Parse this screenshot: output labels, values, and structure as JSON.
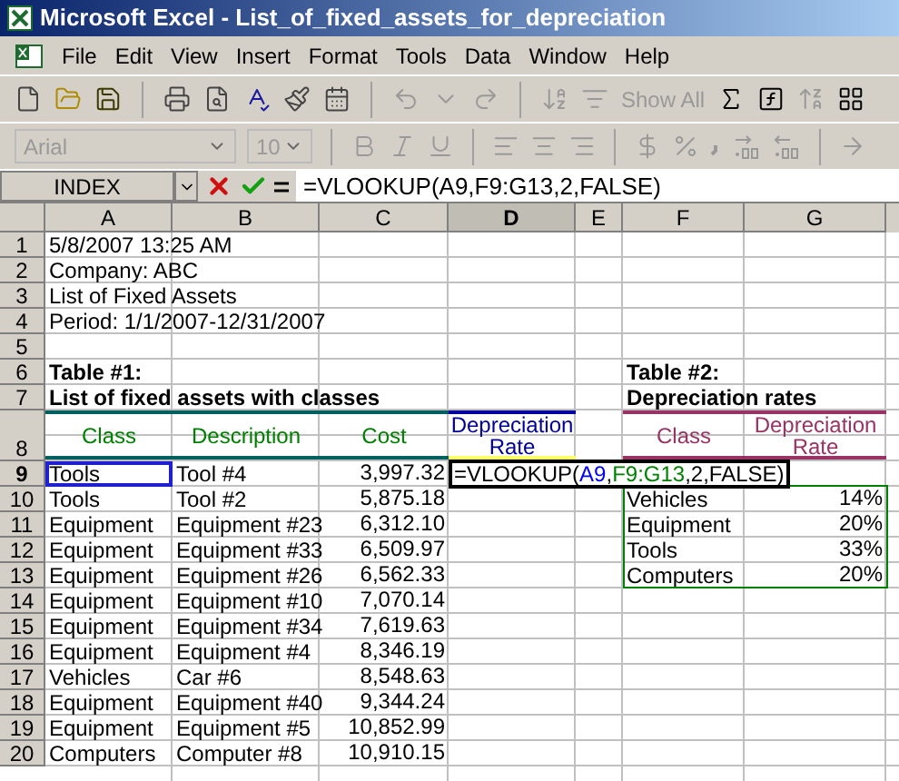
{
  "window": {
    "title": "Microsoft Excel - List_of_fixed_assets_for_depreciation"
  },
  "menu": [
    "File",
    "Edit",
    "View",
    "Insert",
    "Format",
    "Tools",
    "Data",
    "Window",
    "Help"
  ],
  "standard_toolbar": {
    "show_all": "Show All"
  },
  "formatting_toolbar": {
    "font": "Arial",
    "size": "10"
  },
  "formula_bar": {
    "name_box": "INDEX",
    "formula": "=VLOOKUP(A9,F9:G13,2,FALSE)"
  },
  "columns": [
    {
      "label": "A",
      "selected": false
    },
    {
      "label": "B",
      "selected": false
    },
    {
      "label": "C",
      "selected": false
    },
    {
      "label": "D",
      "selected": true
    },
    {
      "label": "E",
      "selected": false
    },
    {
      "label": "F",
      "selected": false
    },
    {
      "label": "G",
      "selected": false
    }
  ],
  "rows": [
    {
      "number": "1",
      "selected": false,
      "kind": "plain",
      "cells": [
        "5/8/2007 13:25 AM",
        "",
        "",
        "",
        "",
        "",
        ""
      ]
    },
    {
      "number": "2",
      "selected": false,
      "kind": "plain",
      "cells": [
        "Company: ABC",
        "",
        "",
        "",
        "",
        "",
        ""
      ]
    },
    {
      "number": "3",
      "selected": false,
      "kind": "plain",
      "cells": [
        "List of Fixed Assets",
        "",
        "",
        "",
        "",
        "",
        ""
      ]
    },
    {
      "number": "4",
      "selected": false,
      "kind": "plain",
      "cells": [
        "Period: 1/1/2007-12/31/2007",
        "",
        "",
        "",
        "",
        "",
        ""
      ]
    },
    {
      "number": "5",
      "selected": false,
      "kind": "plain",
      "cells": [
        "",
        "",
        "",
        "",
        "",
        "",
        ""
      ]
    },
    {
      "number": "6",
      "selected": false,
      "kind": "title",
      "cells": [
        "Table #1:",
        "",
        "",
        "",
        "",
        "Table #2:",
        ""
      ]
    },
    {
      "number": "7",
      "selected": false,
      "kind": "title",
      "cells": [
        "List of fixed assets with classes",
        "",
        "",
        "",
        "",
        "Depreciation rates",
        ""
      ]
    },
    {
      "number": "8",
      "selected": false,
      "kind": "header",
      "cells": [
        {
          "text": "Class",
          "color": "#008000"
        },
        {
          "text": "Description",
          "color": "#008000"
        },
        {
          "text": "Cost",
          "color": "#008000"
        },
        {
          "text": "Depreciation Rate",
          "color": "#000099"
        },
        "",
        {
          "text": "Class",
          "color": "#993366"
        },
        {
          "text": "Depreciation Rate",
          "color": "#993366"
        }
      ]
    },
    {
      "number": "9",
      "selected": true,
      "kind": "data",
      "cells": [
        "Tools",
        "Tool #4",
        "3,997.32",
        "",
        "",
        "",
        ""
      ]
    },
    {
      "number": "10",
      "selected": false,
      "kind": "data",
      "cells": [
        "Tools",
        "Tool #2",
        "5,875.18",
        "",
        "",
        "Vehicles",
        "14%"
      ]
    },
    {
      "number": "11",
      "selected": false,
      "kind": "data",
      "cells": [
        "Equipment",
        "Equipment #23",
        "6,312.10",
        "",
        "",
        "Equipment",
        "20%"
      ]
    },
    {
      "number": "12",
      "selected": false,
      "kind": "data",
      "cells": [
        "Equipment",
        "Equipment #33",
        "6,509.97",
        "",
        "",
        "Tools",
        "33%"
      ]
    },
    {
      "number": "13",
      "selected": false,
      "kind": "data",
      "cells": [
        "Equipment",
        "Equipment #26",
        "6,562.33",
        "",
        "",
        "Computers",
        "20%"
      ]
    },
    {
      "number": "14",
      "selected": false,
      "kind": "data",
      "cells": [
        "Equipment",
        "Equipment #10",
        "7,070.14",
        "",
        "",
        "",
        ""
      ]
    },
    {
      "number": "15",
      "selected": false,
      "kind": "data",
      "cells": [
        "Equipment",
        "Equipment #34",
        "7,619.63",
        "",
        "",
        "",
        ""
      ]
    },
    {
      "number": "16",
      "selected": false,
      "kind": "data",
      "cells": [
        "Equipment",
        "Equipment #4",
        "8,346.19",
        "",
        "",
        "",
        ""
      ]
    },
    {
      "number": "17",
      "selected": false,
      "kind": "data",
      "cells": [
        "Vehicles",
        "Car #6",
        "8,548.63",
        "",
        "",
        "",
        ""
      ]
    },
    {
      "number": "18",
      "selected": false,
      "kind": "data",
      "cells": [
        "Equipment",
        "Equipment #40",
        "9,344.24",
        "",
        "",
        "",
        ""
      ]
    },
    {
      "number": "19",
      "selected": false,
      "kind": "data",
      "cells": [
        "Equipment",
        "Equipment #5",
        "10,852.99",
        "",
        "",
        "",
        ""
      ]
    },
    {
      "number": "20",
      "selected": false,
      "kind": "data",
      "cells": [
        "Computers",
        "Computer #8",
        "10,910.15",
        "",
        "",
        "",
        ""
      ]
    }
  ],
  "cell_editor": {
    "parts": [
      {
        "text": "=VLOOKUP(",
        "color": "#000000"
      },
      {
        "text": "A9",
        "color": "#0000ff"
      },
      {
        "text": ",",
        "color": "#000000"
      },
      {
        "text": "F9:G13",
        "color": "#008000"
      },
      {
        "text": ",2,FALSE)",
        "color": "#000000"
      }
    ]
  }
}
